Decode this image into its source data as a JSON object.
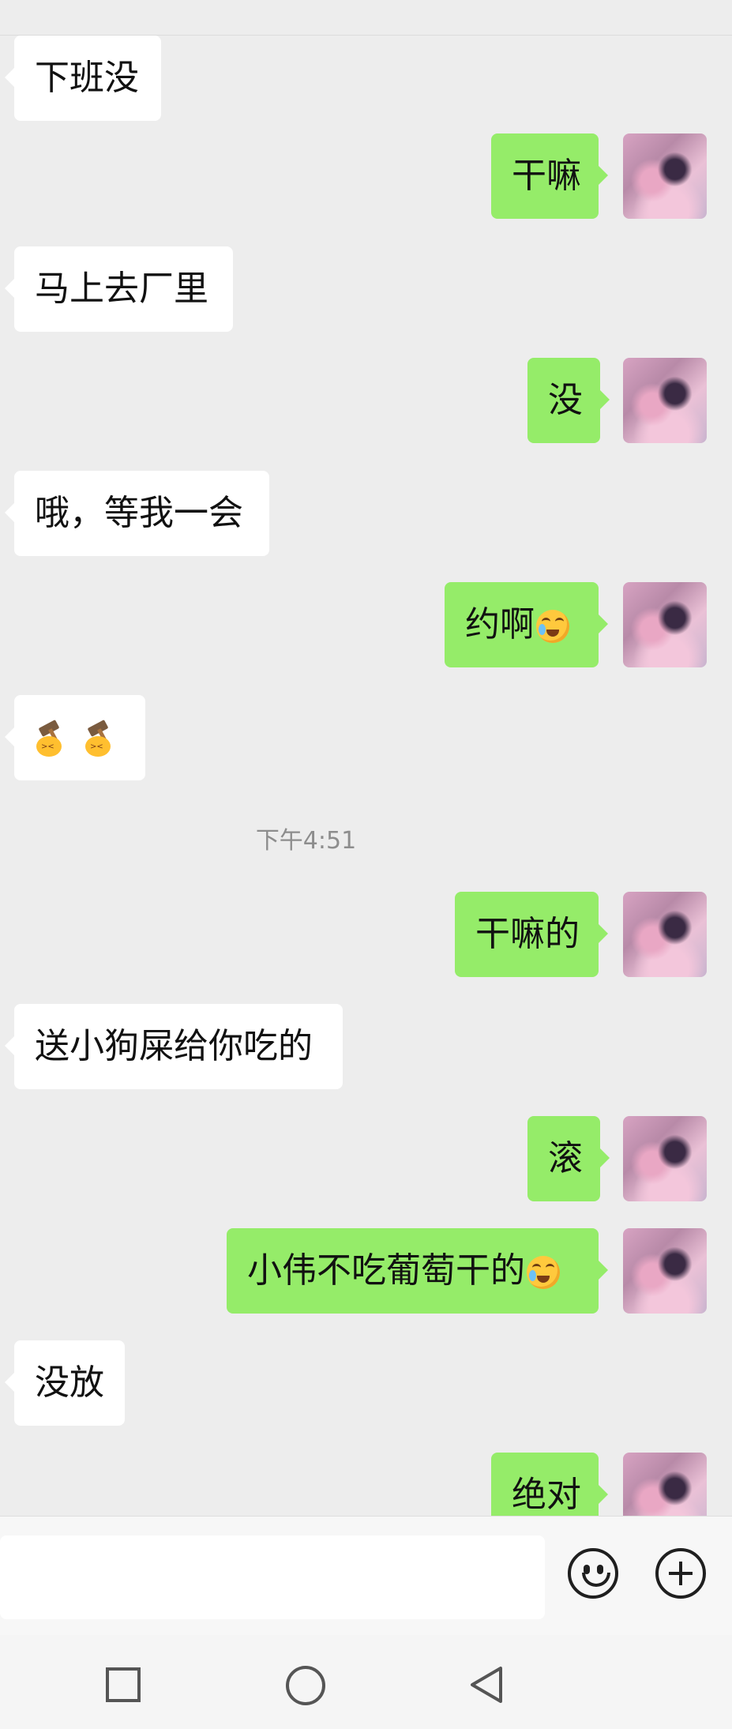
{
  "messages": [
    {
      "side": "left",
      "text": "下班没"
    },
    {
      "side": "right",
      "text": "干嘛"
    },
    {
      "side": "left",
      "text": "马上去厂里"
    },
    {
      "side": "right",
      "text": "没"
    },
    {
      "side": "left",
      "text": "哦，等我一会"
    },
    {
      "side": "right",
      "text": "约啊",
      "emoji": "facepalm-laugh-cry"
    },
    {
      "side": "left",
      "emoji": "hammer-emoji-x2"
    },
    {
      "side": "right",
      "text": "干嘛的"
    },
    {
      "side": "left",
      "text": "送小狗屎给你吃的"
    },
    {
      "side": "right",
      "text": "滚"
    },
    {
      "side": "right",
      "text": "小伟不吃葡萄干的",
      "emoji": "facepalm-laugh-cry"
    },
    {
      "side": "left",
      "text": "没放"
    },
    {
      "side": "right",
      "text": "绝对"
    }
  ],
  "timestamp": "下午4:51",
  "input": {
    "placeholder": ""
  },
  "icons": {
    "emoji_button": "smiley-face-icon",
    "more_button": "plus-circle-icon",
    "nav_recent": "square-icon",
    "nav_home": "circle-icon",
    "nav_back": "triangle-back-icon"
  },
  "colors": {
    "background": "#ededed",
    "sent_bubble": "#95ec69",
    "received_bubble": "#ffffff",
    "timestamp_text": "#8d8d8d"
  }
}
